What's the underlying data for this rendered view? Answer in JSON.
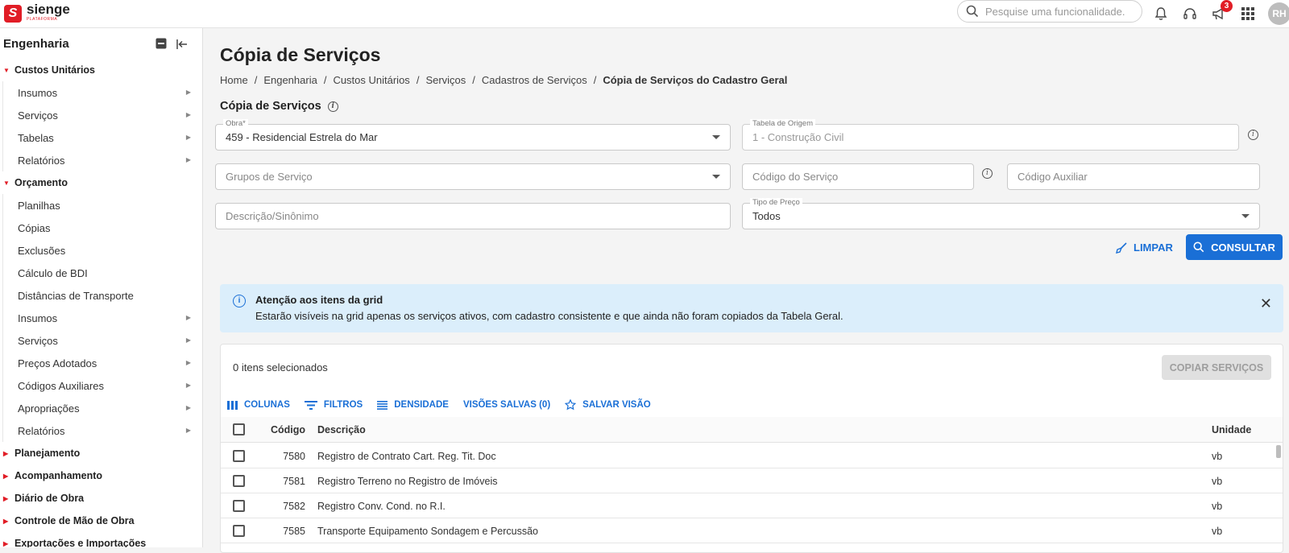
{
  "app": {
    "brand": "sienge",
    "brand_sub": "PLATAFORMA"
  },
  "header": {
    "search_placeholder": "Pesquise uma funcionalidade.",
    "notifications_badge": "3",
    "avatar": "RH"
  },
  "sidebar": {
    "title": "Engenharia",
    "groups": [
      {
        "label": "Custos Unitários",
        "expanded": true,
        "items": [
          {
            "label": "Insumos",
            "arrow": true
          },
          {
            "label": "Serviços",
            "arrow": true
          },
          {
            "label": "Tabelas",
            "arrow": true
          },
          {
            "label": "Relatórios",
            "arrow": true
          }
        ]
      },
      {
        "label": "Orçamento",
        "expanded": true,
        "items": [
          {
            "label": "Planilhas",
            "arrow": false
          },
          {
            "label": "Cópias",
            "arrow": false
          },
          {
            "label": "Exclusões",
            "arrow": false
          },
          {
            "label": "Cálculo de BDI",
            "arrow": false
          },
          {
            "label": "Distâncias de Transporte",
            "arrow": false
          },
          {
            "label": "Insumos",
            "arrow": true
          },
          {
            "label": "Serviços",
            "arrow": true
          },
          {
            "label": "Preços Adotados",
            "arrow": true
          },
          {
            "label": "Códigos Auxiliares",
            "arrow": true
          },
          {
            "label": "Apropriações",
            "arrow": true
          },
          {
            "label": "Relatórios",
            "arrow": true
          }
        ]
      },
      {
        "label": "Planejamento",
        "expanded": false,
        "items": []
      },
      {
        "label": "Acompanhamento",
        "expanded": false,
        "items": []
      },
      {
        "label": "Diário de Obra",
        "expanded": false,
        "items": []
      },
      {
        "label": "Controle de Mão de Obra",
        "expanded": false,
        "items": []
      },
      {
        "label": "Exportações e Importações",
        "expanded": false,
        "items": []
      }
    ]
  },
  "main": {
    "title": "Cópia de Serviços",
    "breadcrumb": [
      "Home",
      "Engenharia",
      "Custos Unitários",
      "Serviços",
      "Cadastros de Serviços"
    ],
    "breadcrumb_current": "Cópia de Serviços do Cadastro Geral",
    "section_title": "Cópia de Serviços",
    "form": {
      "obra_label": "Obra*",
      "obra_value": "459 - Residencial Estrela do Mar",
      "tabela_label": "Tabela de Origem",
      "tabela_value": "1 - Construção Civil",
      "grupos_placeholder": "Grupos de Serviço",
      "codigo_placeholder": "Código do Serviço",
      "auxiliar_placeholder": "Código Auxiliar",
      "descricao_placeholder": "Descrição/Sinônimo",
      "tipo_label": "Tipo de Preço",
      "tipo_value": "Todos"
    },
    "buttons": {
      "limpar": "LIMPAR",
      "consultar": "CONSULTAR"
    },
    "alert": {
      "title": "Atenção aos itens da grid",
      "text": "Estarão visíveis na grid apenas os serviços ativos, com cadastro consistente e que ainda não foram copiados da Tabela Geral."
    },
    "grid": {
      "selected": "0 itens selecionados",
      "copy_button": "COPIAR SERVIÇOS",
      "toolbar": {
        "colunas": "COLUNAS",
        "filtros": "FILTROS",
        "densidade": "DENSIDADE",
        "visoes": "VISÕES SALVAS (0)",
        "salvar": "SALVAR VISÃO"
      },
      "columns": {
        "codigo": "Código",
        "descricao": "Descrição",
        "unidade": "Unidade"
      },
      "rows": [
        {
          "codigo": "7580",
          "descricao": "Registro de Contrato Cart. Reg. Tit. Doc",
          "unidade": "vb"
        },
        {
          "codigo": "7581",
          "descricao": "Registro Terreno no Registro de Imóveis",
          "unidade": "vb"
        },
        {
          "codigo": "7582",
          "descricao": "Registro Conv. Cond. no R.I.",
          "unidade": "vb"
        },
        {
          "codigo": "7585",
          "descricao": "Transporte Equipamento Sondagem e Percussão",
          "unidade": "vb"
        }
      ]
    }
  }
}
